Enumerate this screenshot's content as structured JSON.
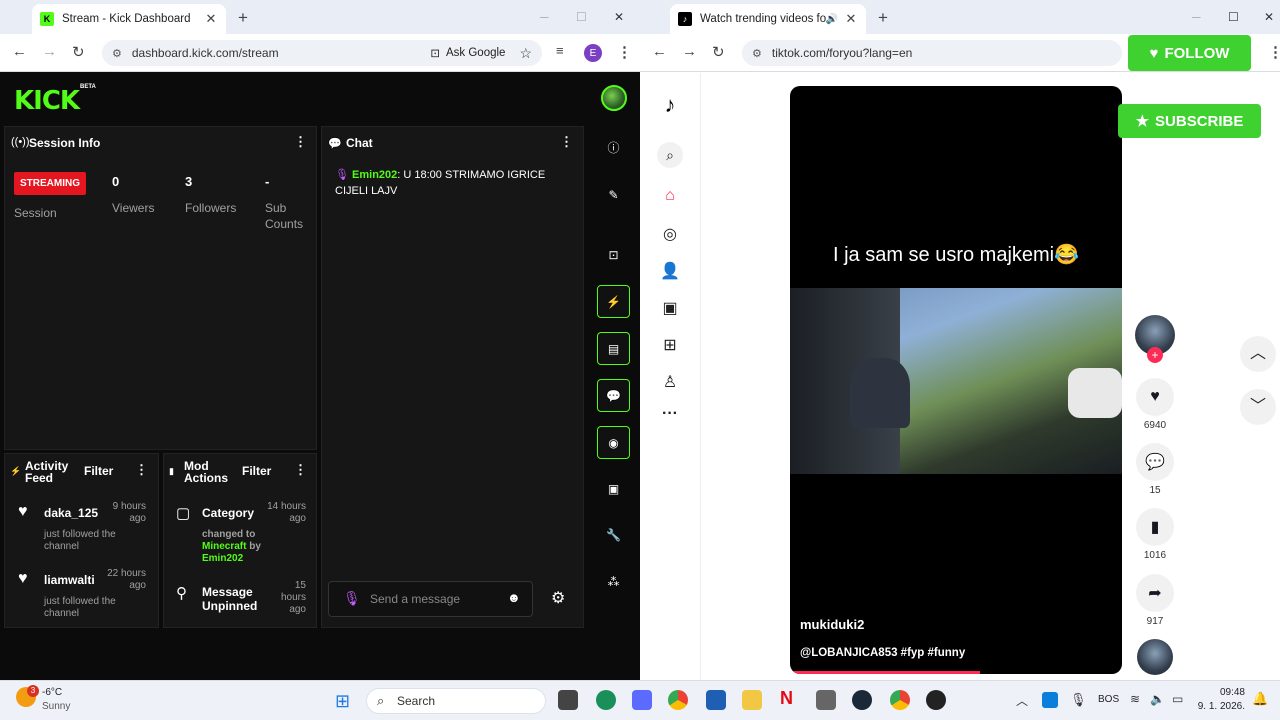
{
  "left_browser": {
    "tab_title": "Stream - Kick Dashboard",
    "url": "dashboard.kick.com/stream",
    "ask_google": "Ask Google",
    "profile_initial": "E"
  },
  "right_browser": {
    "tab_title": "Watch trending videos for y",
    "url": "tiktok.com/foryou?lang=en"
  },
  "kick": {
    "logo": "KICK",
    "beta": "BETA",
    "session": {
      "title": "Session Info",
      "status": "STREAMING",
      "session_label": "Session",
      "viewers_value": "0",
      "viewers_label": "Viewers",
      "followers_value": "3",
      "followers_label": "Followers",
      "subs_value": "-",
      "subs_label": "Sub Counts"
    },
    "chat": {
      "title": "Chat",
      "messages": [
        {
          "user": "Emin202",
          "text": ": U 18:00 STRIMAMO IGRICE CIJELI LAJV"
        }
      ],
      "placeholder": "Send a message"
    },
    "activity": {
      "title": "Activity Feed",
      "filter": "Filter",
      "items": [
        {
          "name": "daka_125",
          "sub": "just followed the channel",
          "time": "9 hours ago"
        },
        {
          "name": "liamwalti",
          "sub": "just followed the channel",
          "time": "22 hours ago"
        }
      ]
    },
    "mod": {
      "title": "Mod Actions",
      "filter": "Filter",
      "items": [
        {
          "name": "Category",
          "sub_prefix": "changed to",
          "sub_link": "Minecraft",
          "sub_by": "by",
          "sub_user": "Emin202",
          "time": "14 hours ago"
        },
        {
          "name": "Message Unpinned",
          "time": "15 hours ago"
        }
      ]
    }
  },
  "tiktok": {
    "caption": "I ja sam se usro majkemi😂",
    "author": "mukiduki2",
    "description": "@LOBANJICA853 #fyp #funny",
    "likes": "6940",
    "comments": "15",
    "saves": "1016",
    "shares": "917",
    "follow_overlay": "FOLLOW",
    "subscribe_overlay": "SUBSCRIBE"
  },
  "taskbar": {
    "weather_temp": "-6°C",
    "weather_desc": "Sunny",
    "weather_badge": "3",
    "search": "Search",
    "lang": "BOS",
    "time": "09:48",
    "date": "9. 1. 2026."
  },
  "colors": {
    "kick_green": "#53fc18",
    "streaming_red": "#e5161f",
    "tiktok_red": "#fe2c55"
  }
}
